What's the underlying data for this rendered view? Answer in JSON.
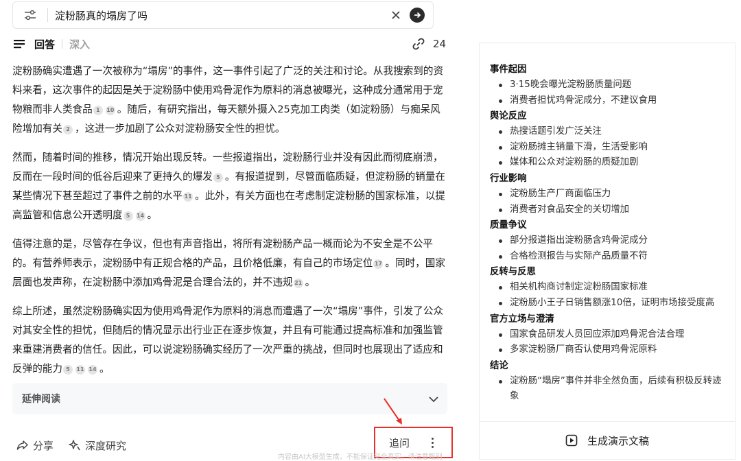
{
  "search": {
    "query": "淀粉肠真的塌房了吗"
  },
  "answer_header": {
    "tab_answer": "回答",
    "tab_deep": "深入",
    "links_count": "24"
  },
  "answer": {
    "paragraphs": [
      [
        {
          "t": "淀粉肠确实遭遇了一次被称为“塌房”的事件，这一事件引起了广泛的关注和讨论。从我搜索到的资料来看，这次事件的起因是关于淀粉肠中使用鸡骨泥作为原料的消息被曝光，这种成分通常用于宠物粮而非人类食品"
        },
        {
          "r": "1"
        },
        {
          "r": "10"
        },
        {
          "t": "。随后，有研究指出，每天额外摄入25克加工肉类（如淀粉肠）与痴呆风险增加有关"
        },
        {
          "r": "2"
        },
        {
          "t": "，这进一步加剧了公众对淀粉肠安全性的担忧。"
        }
      ],
      [
        {
          "t": "然而，随着时间的推移，情况开始出现反转。一些报道指出，淀粉肠行业并没有因此而彻底崩溃，反而在一段时间的低谷后迎来了更持久的爆发"
        },
        {
          "r": "5"
        },
        {
          "t": "。有报道提到，尽管面临质疑，但淀粉肠的销量在某些情况下甚至超过了事件之前的水平"
        },
        {
          "r": "11"
        },
        {
          "t": "。此外，有关方面也在考虑制定淀粉肠的国家标准，以提高监管和信息公开透明度"
        },
        {
          "r": "5"
        },
        {
          "r": "14"
        },
        {
          "t": "。"
        }
      ],
      [
        {
          "t": "值得注意的是，尽管存在争议，但也有声音指出，将所有淀粉肠产品一概而论为不安全是不公平的。有营养师表示，淀粉肠中有正规合格的产品，且价格低廉，有自己的市场定位"
        },
        {
          "r": "17"
        },
        {
          "t": "。同时，国家层面也发声称，在淀粉肠中添加鸡骨泥是合理合法的，并不违规"
        },
        {
          "r": "21"
        },
        {
          "t": "。"
        }
      ],
      [
        {
          "t": "综上所述，虽然淀粉肠确实因为使用鸡骨泥作为原料的消息而遭遇了一次“塌房”事件，引发了公众对其安全性的担忧，但随后的情况显示出行业正在逐步恢复，并且有可能通过提高标准和加强监管来重建消费者的信任。因此，可以说淀粉肠确实经历了一次严重的挑战，但同时也展现出了适应和反弹的能力"
        },
        {
          "r": "5"
        },
        {
          "r": "11"
        },
        {
          "r": "14"
        },
        {
          "t": "。"
        }
      ]
    ]
  },
  "extend_reading": {
    "label": "延伸阅读"
  },
  "toolbar": {
    "share": "分享",
    "deep_research": "深度研究",
    "followup": "追问"
  },
  "disclaimer": "内容由AI大模型生成，不能保证完全真实，请注意甄别",
  "mindmap": [
    {
      "head": "事件起因",
      "items": [
        "3·15晚会曝光淀粉肠质量问题",
        "消费者担忧鸡骨泥成分，不建议食用"
      ]
    },
    {
      "head": "舆论反应",
      "items": [
        "热搜话题引发广泛关注",
        "淀粉肠摊主销量下滑，生活受影响",
        "媒体和公众对淀粉肠的质疑加剧"
      ]
    },
    {
      "head": "行业影响",
      "items": [
        "淀粉肠生产厂商面临压力",
        "消费者对食品安全的关切增加"
      ]
    },
    {
      "head": "质量争议",
      "items": [
        "部分报道指出淀粉肠含鸡骨泥成分",
        "合格检测报告与实际产品质量不符"
      ]
    },
    {
      "head": "反转与反思",
      "items": [
        "相关机构商讨制定淀粉肠国家标准",
        "淀粉肠小王子日销售额涨10倍，证明市场接受度高"
      ]
    },
    {
      "head": "官方立场与澄清",
      "items": [
        "国家食品研发人员回应添加鸡骨泥合法合理",
        "多家淀粉肠厂商否认使用鸡骨泥原料"
      ]
    },
    {
      "head": "结论",
      "items": [
        "淀粉肠“塌房”事件并非全然负面，后续有积极反转迹象"
      ]
    }
  ],
  "generate_slides": "生成演示文稿"
}
